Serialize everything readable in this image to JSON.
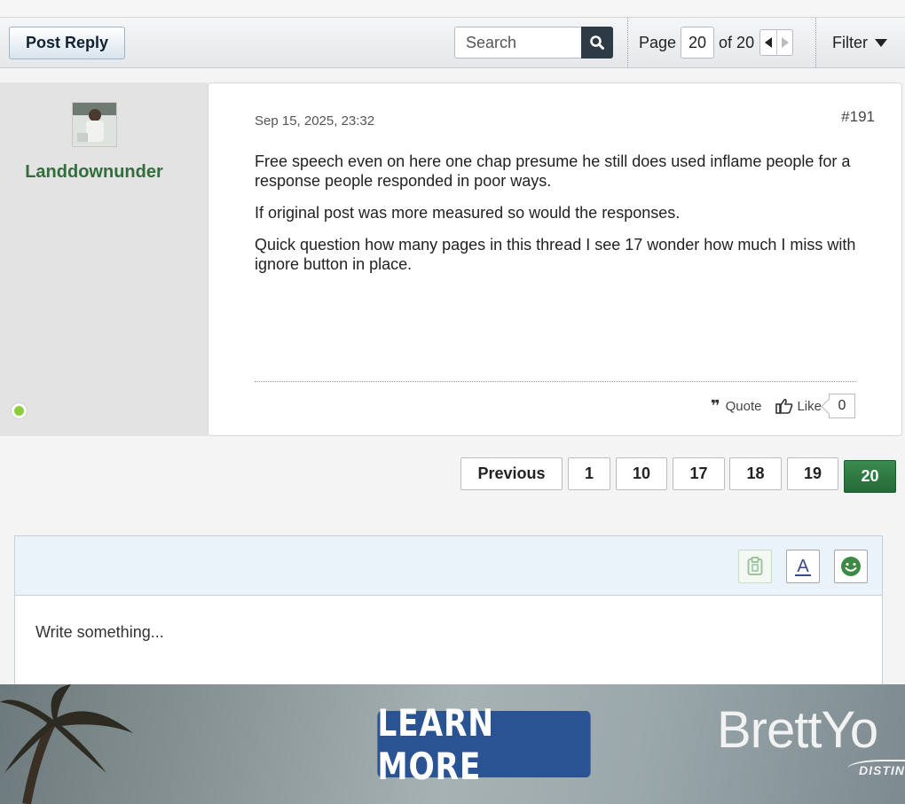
{
  "toolbar": {
    "post_reply": "Post Reply",
    "search_placeholder": "Search",
    "page_label": "Page",
    "current_page": "20",
    "of_label": "of 20",
    "filter_label": "Filter"
  },
  "post": {
    "username": "Landdownunder",
    "date": "Sep 15, 2025, 23:32",
    "number": "#191",
    "paragraphs": [
      "Free speech even on here one chap presume he still does used inflame people for a response people responded in poor ways.",
      "If original post was more measured so would the responses.",
      "Quick question how many pages in this thread I see 17 wonder how much I miss with ignore button in place."
    ],
    "quote_label": "Quote",
    "like_label": "Like",
    "like_count": "0"
  },
  "pagination": {
    "previous": "Previous",
    "pages": [
      "1",
      "10",
      "17",
      "18",
      "19",
      "20"
    ],
    "active": "20"
  },
  "editor": {
    "placeholder": "Write something..."
  },
  "ad": {
    "button": "LEARN MORE",
    "brand": "BrettYo",
    "tagline": "DISTIN"
  },
  "colors": {
    "username_green": "#2f6f3a",
    "active_page_green": "#2e7a43",
    "ad_button_blue": "#2a5394",
    "online_dot": "#8ccd3d"
  }
}
